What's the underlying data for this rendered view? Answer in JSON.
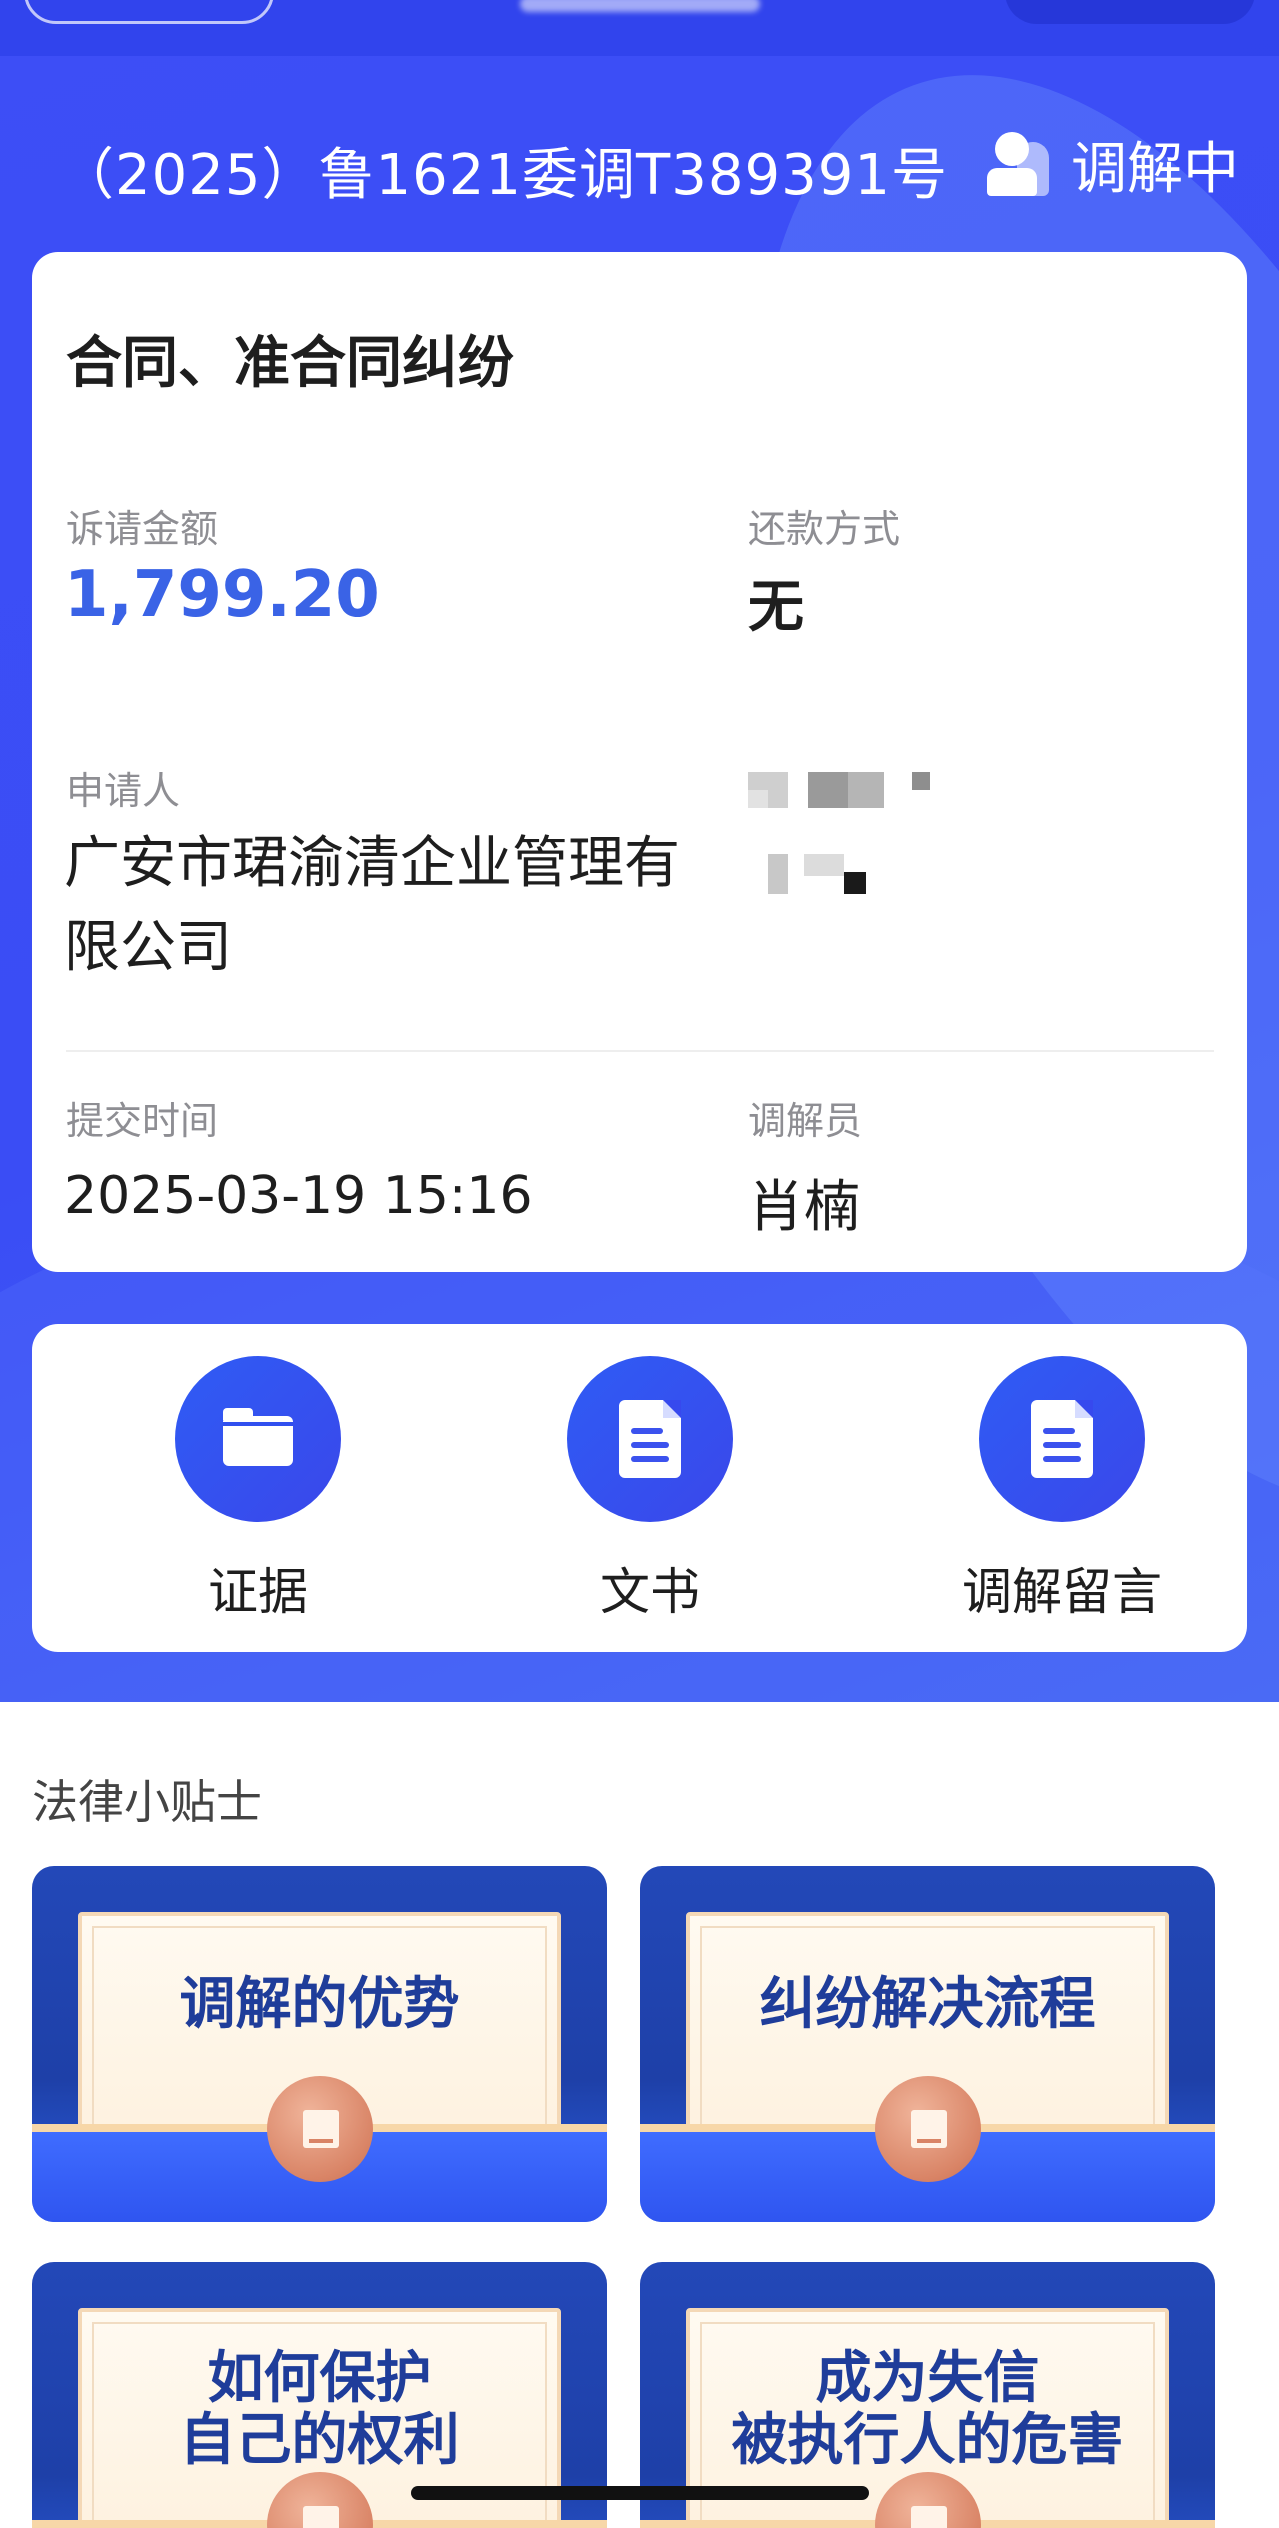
{
  "case": {
    "number": "（2025）鲁1621委调T389391号",
    "status": "调解中",
    "type": "合同、准合同纠纷",
    "claim_amount_label": "诉请金额",
    "claim_amount": "1,799.20",
    "repayment_label": "还款方式",
    "repayment_value": "无",
    "applicant_label": "申请人",
    "applicant_name": "广安市珺渝清企业管理有限公司",
    "submit_time_label": "提交时间",
    "submit_time": "2025-03-19 15:16",
    "mediator_label": "调解员",
    "mediator_name": "肖楠"
  },
  "actions": [
    {
      "label": "证据",
      "icon": "folder-icon"
    },
    {
      "label": "文书",
      "icon": "document-icon"
    },
    {
      "label": "调解留言",
      "icon": "document-icon"
    }
  ],
  "tips": {
    "title": "法律小贴士",
    "items": [
      {
        "line1": "调解的优势",
        "line2": ""
      },
      {
        "line1": "纠纷解决流程",
        "line2": ""
      },
      {
        "line1": "如何保护",
        "line2": "自己的权利"
      },
      {
        "line1": "成为失信",
        "line2": "被执行人的危害"
      }
    ]
  },
  "colors": {
    "brand_blue": "#3d4ef6",
    "amount_blue": "#3a63e6",
    "tip_navy": "#1f3d9a"
  }
}
